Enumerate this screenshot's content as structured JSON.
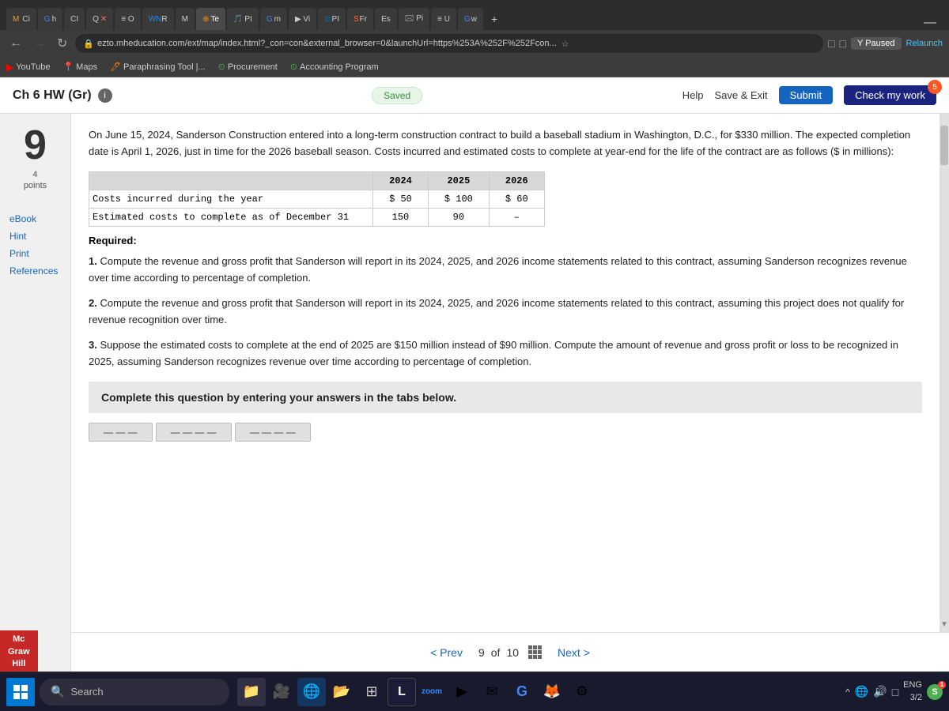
{
  "browser": {
    "tabs": [
      {
        "label": "Mc",
        "active": false
      },
      {
        "label": "G h",
        "active": false
      },
      {
        "label": "CI",
        "active": false
      },
      {
        "label": "Q ×",
        "active": false
      },
      {
        "label": "≡ O",
        "active": false
      },
      {
        "label": "WN R",
        "active": false
      },
      {
        "label": "M",
        "active": false
      },
      {
        "label": "Te",
        "active": false
      },
      {
        "label": "PI",
        "active": false
      },
      {
        "label": "G m",
        "active": false
      },
      {
        "label": "Vi",
        "active": false
      },
      {
        "label": "O PI",
        "active": false
      },
      {
        "label": "S Fr",
        "active": false
      },
      {
        "label": "Es",
        "active": false
      },
      {
        "label": "Pi",
        "active": false
      },
      {
        "label": "≡ U",
        "active": false
      },
      {
        "label": "G w",
        "active": false
      },
      {
        "label": "+",
        "active": false
      }
    ],
    "address": "ezto.mheducation.com/ext/map/index.html?_con=con&external_browser=0&launchUrl=https%253A%252F%252Fcon...",
    "bookmarks": [
      "YouTube",
      "Maps",
      "Paraphrasing Tool |...",
      "Procurement",
      "Accounting Program"
    ],
    "paused_label": "Y Paused",
    "relaunch_label": "Relaunch"
  },
  "app": {
    "title": "Ch 6 HW (Gr)",
    "saved_label": "Saved",
    "help_label": "Help",
    "save_exit_label": "Save & Exit",
    "submit_label": "Submit",
    "check_work_label": "Check my work",
    "check_badge": "5"
  },
  "sidebar": {
    "question_number": "9",
    "points_label": "4\npoints",
    "links": [
      "eBook",
      "Hint",
      "Print",
      "References"
    ]
  },
  "question": {
    "body": "On June 15, 2024, Sanderson Construction entered into a long-term construction contract to build a baseball stadium in Washington, D.C., for $330 million. The expected completion date is April 1, 2026, just in time for the 2026 baseball season. Costs incurred and estimated costs to complete at year-end for the life of the contract are as follows ($ in millions):",
    "table": {
      "headers": [
        "",
        "2024",
        "2025",
        "2026"
      ],
      "rows": [
        {
          "label": "Costs incurred during the year",
          "vals": [
            "$ 50",
            "$ 100",
            "$ 60"
          ]
        },
        {
          "label": "Estimated costs to complete as of December 31",
          "vals": [
            "150",
            "90",
            "–"
          ]
        }
      ]
    },
    "required_label": "Required:",
    "requirements": [
      "1. Compute the revenue and gross profit that Sanderson will report in its 2024, 2025, and 2026 income statements related to this contract, assuming Sanderson recognizes revenue over time according to percentage of completion.",
      "2. Compute the revenue and gross profit that Sanderson will report in its 2024, 2025, and 2026 income statements related to this contract, assuming this project does not qualify for revenue recognition over time.",
      "3. Suppose the estimated costs to complete at the end of 2025 are $150 million instead of $90 million. Compute the amount of revenue and gross profit or loss to be recognized in 2025, assuming Sanderson recognizes revenue over time according to percentage of completion."
    ],
    "complete_instruction": "Complete this question by entering your answers in the tabs below."
  },
  "pagination": {
    "prev_label": "< Prev",
    "next_label": "Next >",
    "current": "9",
    "total": "10",
    "of_label": "of"
  },
  "mgh": {
    "brand": "Mc\nGraw\nHill"
  },
  "taskbar": {
    "search_placeholder": "Search",
    "sys_tray": {
      "lang": "ENG",
      "time": "3/2",
      "icons": [
        "^",
        "云",
        "🔊",
        "□"
      ]
    }
  }
}
